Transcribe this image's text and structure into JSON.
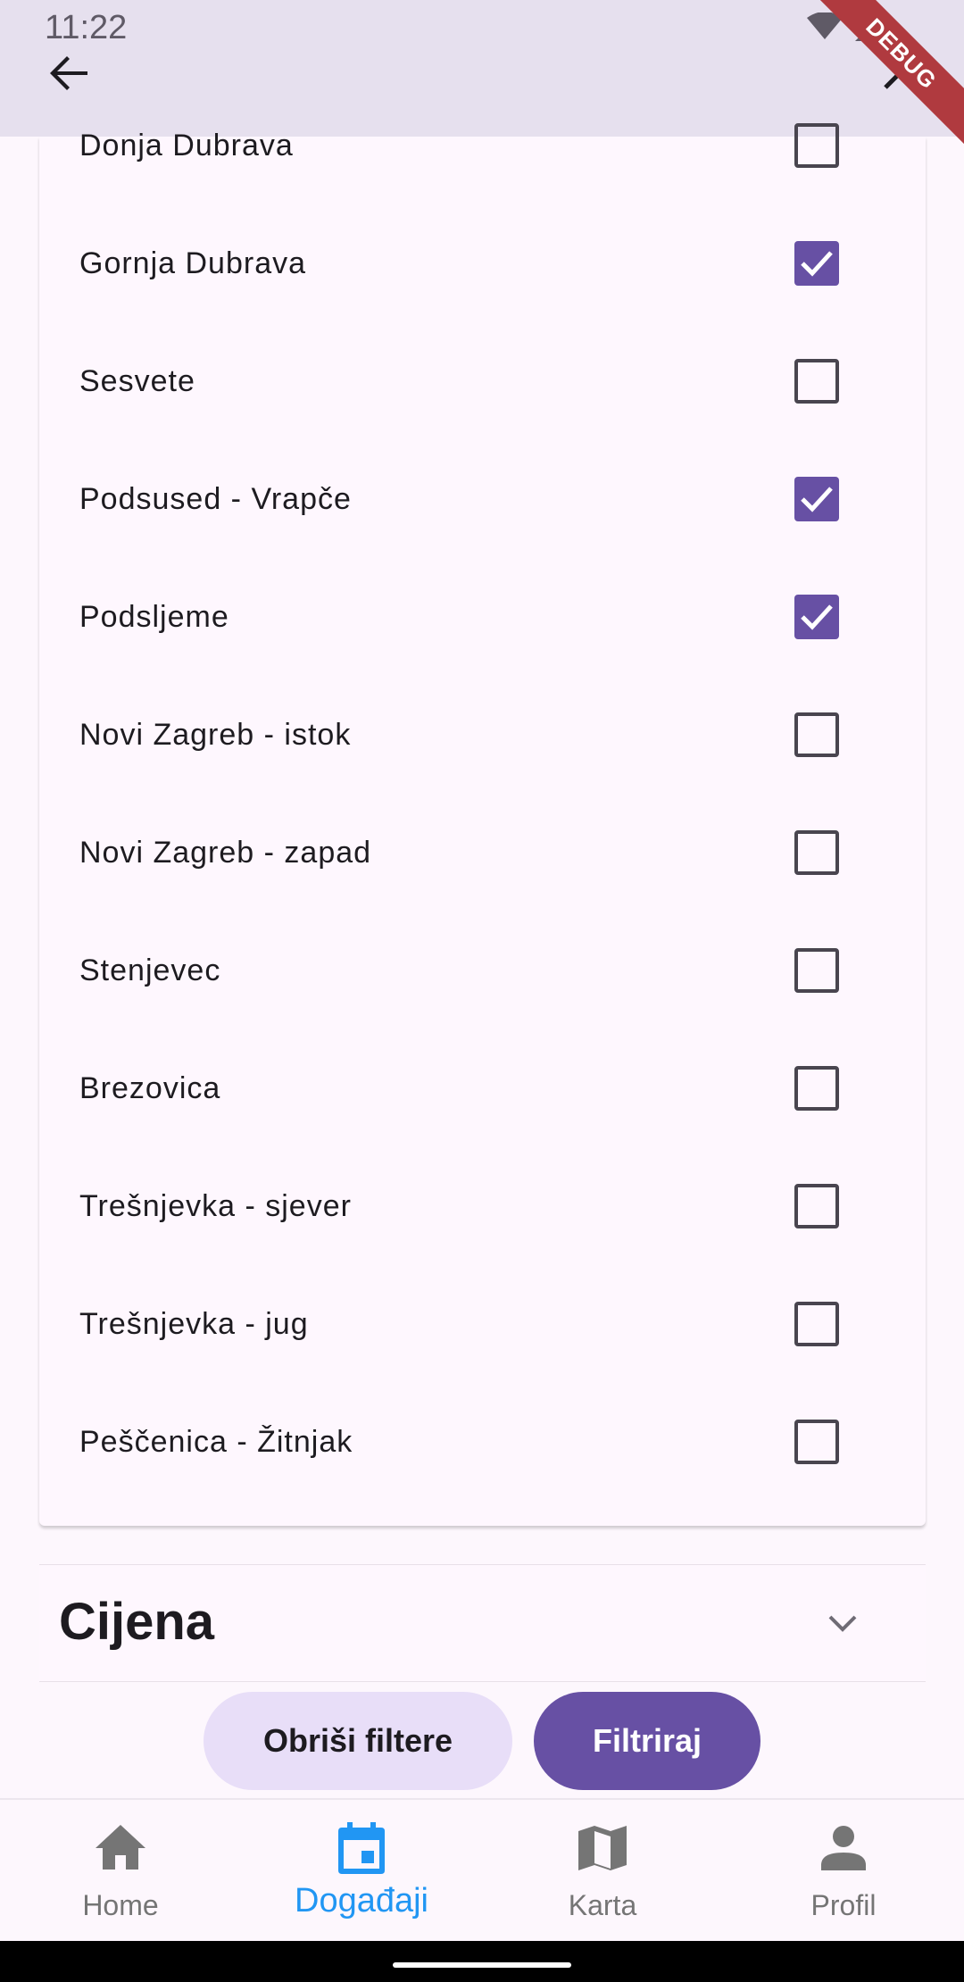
{
  "status_bar": {
    "time": "11:22"
  },
  "debug_banner": "DEBUG",
  "districts": [
    {
      "label": "Donja Dubrava",
      "checked": false
    },
    {
      "label": "Gornja Dubrava",
      "checked": true
    },
    {
      "label": "Sesvete",
      "checked": false
    },
    {
      "label": "Podsused - Vrapče",
      "checked": true
    },
    {
      "label": "Podsljeme",
      "checked": true
    },
    {
      "label": "Novi Zagreb - istok",
      "checked": false
    },
    {
      "label": "Novi Zagreb - zapad",
      "checked": false
    },
    {
      "label": "Stenjevec",
      "checked": false
    },
    {
      "label": "Brezovica",
      "checked": false
    },
    {
      "label": "Trešnjevka - sjever",
      "checked": false
    },
    {
      "label": "Trešnjevka - jug",
      "checked": false
    },
    {
      "label": "Peščenica - Žitnjak",
      "checked": false
    }
  ],
  "price_section": {
    "title": "Cijena"
  },
  "buttons": {
    "clear": "Obriši filtere",
    "filter": "Filtriraj"
  },
  "bottom_nav": [
    {
      "label": "Home",
      "icon": "home-icon",
      "active": false
    },
    {
      "label": "Događaji",
      "icon": "calendar-icon",
      "active": true
    },
    {
      "label": "Karta",
      "icon": "map-icon",
      "active": false
    },
    {
      "label": "Profil",
      "icon": "person-icon",
      "active": false
    }
  ],
  "colors": {
    "accent": "#6750a4",
    "active_nav": "#2196f3",
    "appbar": "#e6e0ee"
  }
}
